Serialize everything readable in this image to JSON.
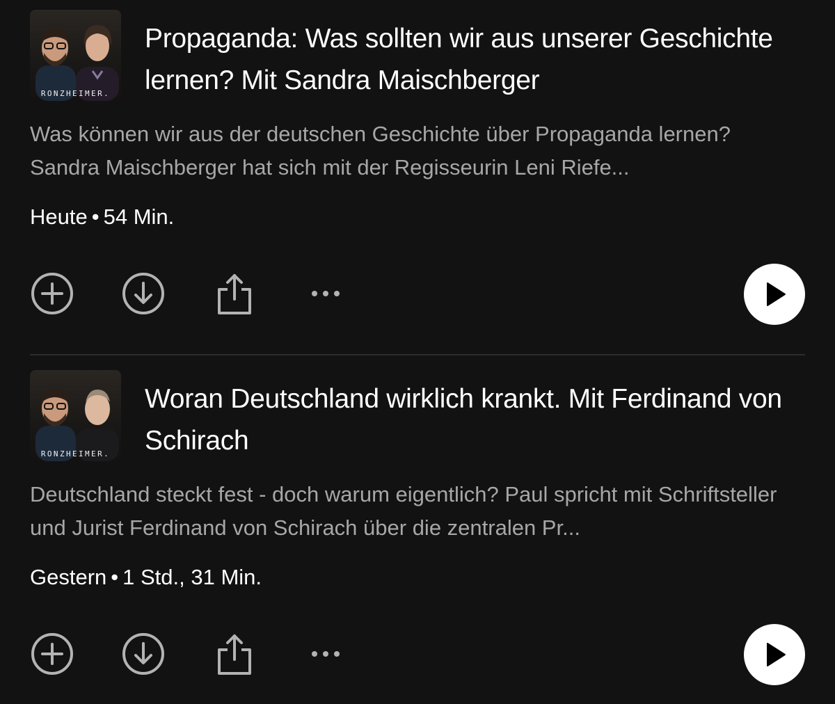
{
  "episodes": [
    {
      "title": "Propaganda: Was sollten wir aus unserer Geschichte lernen? Mit Sandra Maischberger",
      "description": "Was können wir aus der deutschen Geschichte über Propaganda lernen? Sandra Maischberger hat sich mit der Regisseurin Leni Riefe...",
      "date": "Heute",
      "separator": "•",
      "duration": "54 Min.",
      "cover_brand": "RONZHEIMER.",
      "icons": [
        "add-circle-icon",
        "download-circle-icon",
        "share-icon",
        "more-dots-icon",
        "play-icon"
      ]
    },
    {
      "title": "Woran Deutschland wirklich krankt. Mit Ferdinand von Schirach",
      "description": "Deutschland steckt fest - doch warum eigentlich? Paul spricht mit Schriftsteller und Jurist Ferdinand von Schirach über die zentralen Pr...",
      "date": "Gestern",
      "separator": "•",
      "duration": "1 Std., 31 Min.",
      "cover_brand": "RONZHEIMER.",
      "icons": [
        "add-circle-icon",
        "download-circle-icon",
        "share-icon",
        "more-dots-icon",
        "play-icon"
      ]
    }
  ],
  "colors": {
    "background": "#121212",
    "title": "#ffffff",
    "description": "#a7a7a7",
    "icon": "#b3b3b3",
    "play_button": "#ffffff",
    "divider": "#2d2d2d"
  }
}
